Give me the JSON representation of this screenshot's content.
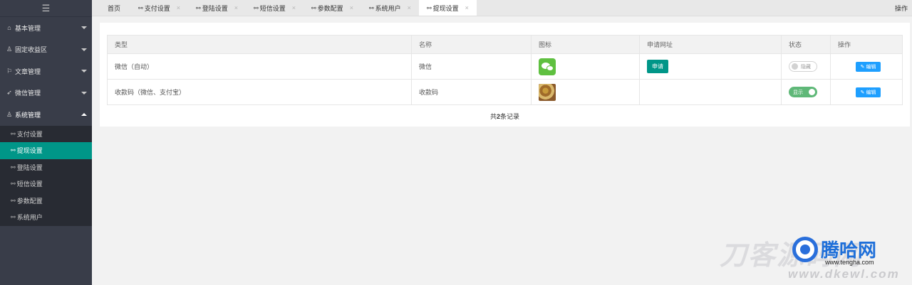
{
  "sidebar": {
    "toggle_icon": "hamburger-icon",
    "menus": [
      {
        "label": "基本管理",
        "icon": "home-icon"
      },
      {
        "label": "固定收益区",
        "icon": "user-icon"
      },
      {
        "label": "文章管理",
        "icon": "flag-icon"
      },
      {
        "label": "微信管理",
        "icon": "send-icon"
      },
      {
        "label": "系统管理",
        "icon": "user-icon"
      }
    ],
    "submenu": [
      {
        "label": "支付设置"
      },
      {
        "label": "提现设置",
        "active": true
      },
      {
        "label": "登陆设置"
      },
      {
        "label": "短信设置"
      },
      {
        "label": "参数配置"
      },
      {
        "label": "系统用户"
      }
    ]
  },
  "tabs": {
    "home": "首页",
    "items": [
      {
        "label": "支付设置"
      },
      {
        "label": "登陆设置"
      },
      {
        "label": "短信设置"
      },
      {
        "label": "参数配置"
      },
      {
        "label": "系统用户"
      },
      {
        "label": "提现设置",
        "active": true
      }
    ],
    "close": "×",
    "ops_label": "操作"
  },
  "table": {
    "headers": [
      "类型",
      "名称",
      "图标",
      "申请网址",
      "状态",
      "操作"
    ],
    "rows": [
      {
        "type": "微信（自动）",
        "name": "微信",
        "icon": "wechat-icon",
        "apply_label": "申请",
        "status": "隐藏",
        "status_on": false,
        "edit_label": "编辑"
      },
      {
        "type": "收款码（微信、支付宝）",
        "name": "收款码",
        "icon": "qr-image-icon",
        "apply_label": "",
        "status": "显示",
        "status_on": true,
        "edit_label": "编辑"
      }
    ],
    "footer_prefix": "共",
    "footer_count": "2",
    "footer_suffix": "条记录"
  },
  "watermark": {
    "big_text": "刀客源码网",
    "brand": "腾哈网",
    "url": "www.tengha.com",
    "url2": "www.dkewl.com"
  },
  "colors": {
    "sidebar_bg": "#393d49",
    "submenu_bg": "#282b33",
    "accent": "#009688",
    "edit_blue": "#1e9fff",
    "switch_on": "#5fb878"
  }
}
